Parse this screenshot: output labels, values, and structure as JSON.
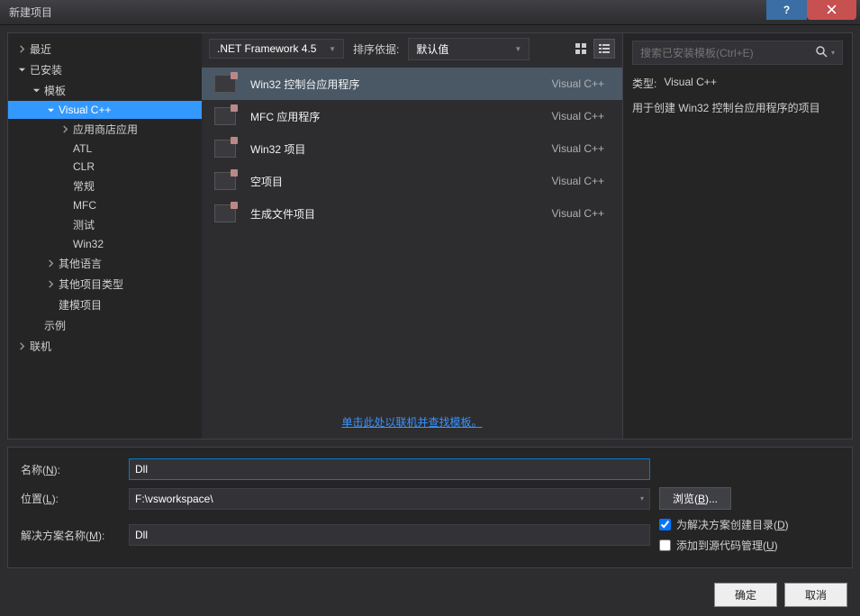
{
  "titlebar": {
    "title": "新建项目"
  },
  "sidebar": {
    "recent": "最近",
    "installed": "已安装",
    "templates": "模板",
    "vcpp": "Visual C++",
    "store": "应用商店应用",
    "atl": "ATL",
    "clr": "CLR",
    "general": "常规",
    "mfc": "MFC",
    "test": "测试",
    "win32": "Win32",
    "other_lang": "其他语言",
    "other_proj": "其他项目类型",
    "modeling": "建模项目",
    "sample": "示例",
    "online": "联机"
  },
  "toolbar": {
    "framework": ".NET Framework 4.5",
    "sort_label": "排序依据:",
    "sort_value": "默认值"
  },
  "search": {
    "placeholder": "搜索已安装模板(Ctrl+E)"
  },
  "templates": [
    {
      "name": "Win32 控制台应用程序",
      "lang": "Visual C++"
    },
    {
      "name": "MFC 应用程序",
      "lang": "Visual C++"
    },
    {
      "name": "Win32 项目",
      "lang": "Visual C++"
    },
    {
      "name": "空项目",
      "lang": "Visual C++"
    },
    {
      "name": "生成文件项目",
      "lang": "Visual C++"
    }
  ],
  "online_link": "单击此处以联机并查找模板。",
  "info": {
    "type_label": "类型:",
    "type_value": "Visual C++",
    "description": "用于创建 Win32 控制台应用程序的项目"
  },
  "form": {
    "name_label": "名称(N):",
    "name_value": "Dll",
    "location_label": "位置(L):",
    "location_value": "F:\\vsworkspace\\",
    "solution_label": "解决方案名称(M):",
    "solution_value": "Dll",
    "browse": "浏览(B)...",
    "create_dir": "为解决方案创建目录(D)",
    "add_source": "添加到源代码管理(U)"
  },
  "buttons": {
    "ok": "确定",
    "cancel": "取消"
  }
}
